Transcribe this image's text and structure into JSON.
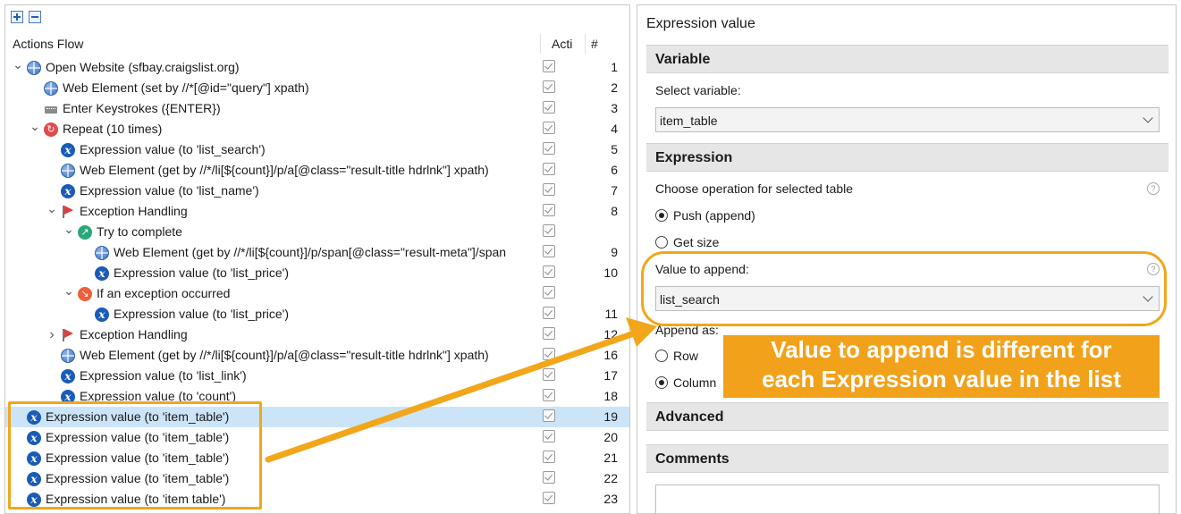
{
  "left_panel": {
    "header": {
      "actions_flow": "Actions Flow",
      "active": "Acti",
      "number": "#"
    },
    "rows": [
      {
        "indent": 0,
        "tw": "v",
        "icon": "globe",
        "label": "Open Website (sfbay.craigslist.org)",
        "num": "1"
      },
      {
        "indent": 1,
        "tw": "",
        "icon": "globe",
        "label": "Web Element (set by //*[@id=\"query\"] xpath)",
        "num": "2"
      },
      {
        "indent": 1,
        "tw": "",
        "icon": "keys",
        "label": "Enter Keystrokes ({ENTER})",
        "num": "3"
      },
      {
        "indent": 1,
        "tw": "v",
        "icon": "repeat",
        "label": "Repeat (10 times)",
        "num": "4"
      },
      {
        "indent": 2,
        "tw": "",
        "icon": "x",
        "label": "Expression value (to 'list_search')",
        "num": "5"
      },
      {
        "indent": 2,
        "tw": "",
        "icon": "globe",
        "label": "Web Element (get by //*/li[${count}]/p/a[@class=\"result-title hdrlnk\"] xpath)",
        "num": "6"
      },
      {
        "indent": 2,
        "tw": "",
        "icon": "x",
        "label": "Expression value (to 'list_name')",
        "num": "7"
      },
      {
        "indent": 2,
        "tw": "v",
        "icon": "flag",
        "label": "Exception Handling",
        "num": "8"
      },
      {
        "indent": 3,
        "tw": "v",
        "icon": "try",
        "label": "Try to complete",
        "num": ""
      },
      {
        "indent": 4,
        "tw": "",
        "icon": "globe",
        "label": "Web Element (get by //*/li[${count}]/p/span[@class=\"result-meta\"]/span",
        "num": "9"
      },
      {
        "indent": 4,
        "tw": "",
        "icon": "x",
        "label": "Expression value (to 'list_price')",
        "num": "10"
      },
      {
        "indent": 3,
        "tw": "v",
        "icon": "exc",
        "label": "If an exception occurred",
        "num": ""
      },
      {
        "indent": 4,
        "tw": "",
        "icon": "x",
        "label": "Expression value (to 'list_price')",
        "num": "11"
      },
      {
        "indent": 2,
        "tw": ">",
        "icon": "flag",
        "label": "Exception Handling",
        "num": "12"
      },
      {
        "indent": 2,
        "tw": "",
        "icon": "globe",
        "label": "Web Element (get by //*/li[${count}]/p/a[@class=\"result-title hdrlnk\"] xpath)",
        "num": "16"
      },
      {
        "indent": 2,
        "tw": "",
        "icon": "x",
        "label": "Expression value (to 'list_link')",
        "num": "17"
      },
      {
        "indent": 2,
        "tw": "",
        "icon": "x",
        "label": "Expression value (to 'count')",
        "num": "18"
      },
      {
        "indent": 0,
        "tw": "",
        "icon": "x",
        "label": "Expression value (to 'item_table')",
        "num": "19",
        "selected": true
      },
      {
        "indent": 0,
        "tw": "",
        "icon": "x",
        "label": "Expression value (to 'item_table')",
        "num": "20"
      },
      {
        "indent": 0,
        "tw": "",
        "icon": "x",
        "label": "Expression value (to 'item_table')",
        "num": "21"
      },
      {
        "indent": 0,
        "tw": "",
        "icon": "x",
        "label": "Expression value (to 'item_table')",
        "num": "22"
      },
      {
        "indent": 0,
        "tw": "",
        "icon": "x",
        "label": "Expression value (to 'item table')",
        "num": "23"
      }
    ]
  },
  "right_panel": {
    "title": "Expression value",
    "variable_section": "Variable",
    "select_variable_label": "Select variable:",
    "select_variable_value": "item_table",
    "expression_section": "Expression",
    "operation_label": "Choose operation for selected table",
    "push_label": "Push (append)",
    "get_size_label": "Get size",
    "value_to_append_label": "Value to append:",
    "value_to_append_value": "list_search",
    "append_as_label": "Append as:",
    "row_label": "Row",
    "column_label": "Column",
    "advanced_section": "Advanced",
    "comments_section": "Comments"
  },
  "callout": {
    "line1": "Value to append is different for",
    "line2": "each Expression value in the list"
  },
  "colors": {
    "highlight": "#f2a61a",
    "selected_row": "#cce4f7",
    "section_bg": "#e6e6e6"
  }
}
